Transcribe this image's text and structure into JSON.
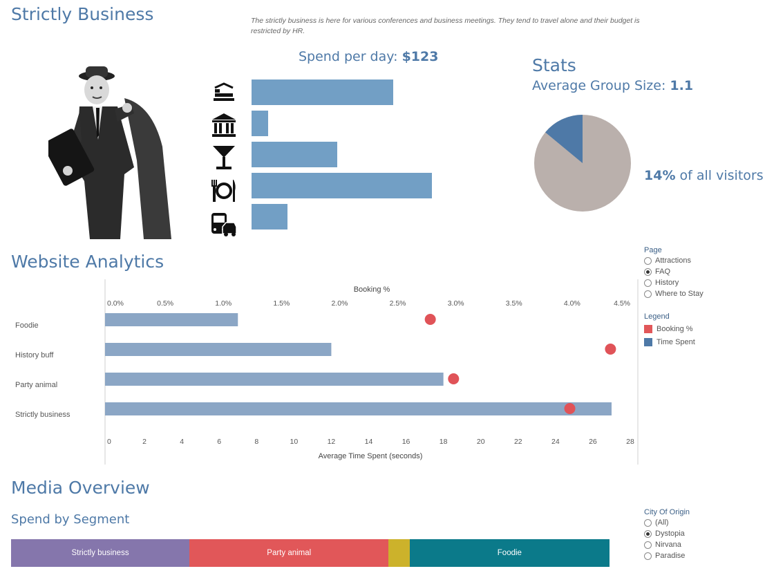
{
  "header": {
    "title": "Strictly Business",
    "description": "The strictly business is here for various conferences and business meetings. They tend to travel alone and their budget is restricted by HR."
  },
  "spend": {
    "label": "Spend per day: ",
    "value": "$123",
    "categories": [
      {
        "icon": "hotel-bed-icon",
        "value": 205
      },
      {
        "icon": "museum-icon",
        "value": 24
      },
      {
        "icon": "cocktail-icon",
        "value": 124
      },
      {
        "icon": "dining-icon",
        "value": 261
      },
      {
        "icon": "transport-icon",
        "value": 52
      }
    ]
  },
  "stats": {
    "title": "Stats",
    "group_label": "Average Group Size: ",
    "group_value": "1.1",
    "share_value": "14%",
    "share_label": " of all visitors",
    "share_fraction": 0.14
  },
  "analytics": {
    "title": "Website Analytics",
    "page_filter": {
      "title": "Page",
      "options": [
        "Attractions",
        "FAQ",
        "History",
        "Where to Stay"
      ],
      "selected": "FAQ"
    },
    "legend": {
      "title": "Legend",
      "items": [
        {
          "label": "Booking %",
          "color": "#e15759"
        },
        {
          "label": "Time Spent",
          "color": "#4e79a7"
        }
      ]
    }
  },
  "chart_data": {
    "type": "bar",
    "categories": [
      "Foodie",
      "History buff",
      "Party animal",
      "Strictly business"
    ],
    "series": [
      {
        "name": "Time Spent",
        "values": [
          7.0,
          12.0,
          18.0,
          27.0
        ]
      },
      {
        "name": "Booking %",
        "values": [
          2.78,
          4.33,
          2.98,
          3.98
        ]
      }
    ],
    "xlabel": "Average Time Spent (seconds)",
    "x2label": "Booking %",
    "xlim": [
      0,
      28
    ],
    "x2lim": [
      0,
      4.5
    ],
    "xticks": [
      "0",
      "2",
      "4",
      "6",
      "8",
      "10",
      "12",
      "14",
      "16",
      "18",
      "20",
      "22",
      "24",
      "26",
      "28"
    ],
    "x2ticks": [
      "0.0%",
      "0.5%",
      "1.0%",
      "1.5%",
      "2.0%",
      "2.5%",
      "3.0%",
      "3.5%",
      "4.0%",
      "4.5%"
    ],
    "colors": {
      "bar": "#8ba6c5",
      "dot": "#e05358"
    }
  },
  "media": {
    "title": "Media Overview",
    "subtitle": "Spend by Segment",
    "segments": [
      {
        "label": "Strictly business",
        "share": 0.298,
        "color": "#8576ac"
      },
      {
        "label": "Party animal",
        "share": 0.333,
        "color": "#e15759"
      },
      {
        "label": "",
        "share": 0.035,
        "color": "#ccb22b"
      },
      {
        "label": "Foodie",
        "share": 0.334,
        "color": "#0b7a8a"
      }
    ],
    "city_filter": {
      "title": "City Of Origin",
      "options": [
        "(All)",
        "Dystopia",
        "Nirvana",
        "Paradise"
      ],
      "selected": "Dystopia"
    }
  }
}
